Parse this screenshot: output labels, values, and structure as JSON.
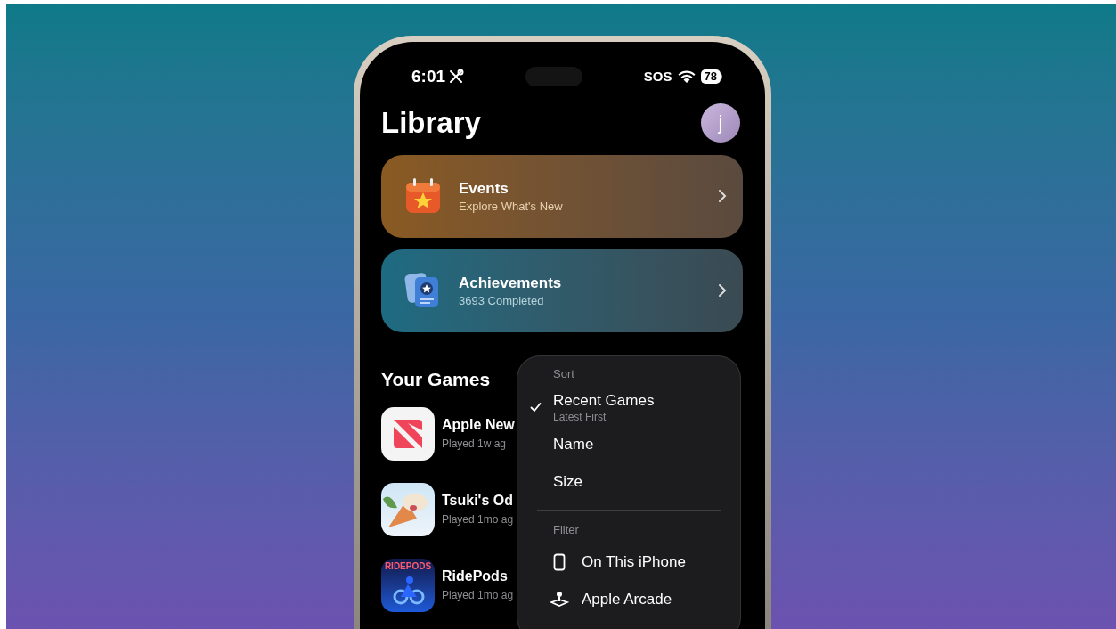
{
  "status_bar": {
    "time": "6:01",
    "sos": "SOS",
    "battery": "78"
  },
  "title": "Library",
  "avatar": {
    "initial": "j"
  },
  "cards": [
    {
      "kind": "events",
      "title": "Events",
      "subtitle": "Explore What's New"
    },
    {
      "kind": "achievements",
      "title": "Achievements",
      "subtitle": "3693 Completed"
    }
  ],
  "section_title": "Your Games",
  "games": [
    {
      "kind": "news",
      "title": "Apple New",
      "subtitle": "Played 1w ag"
    },
    {
      "kind": "tsuki",
      "title": "Tsuki's Od",
      "subtitle": "Played 1mo ag"
    },
    {
      "kind": "ridepods",
      "icon_label": "RIDEPODS",
      "title": "RidePods",
      "subtitle": "Played 1mo ag"
    }
  ],
  "menu": {
    "sections": [
      {
        "header": "Sort",
        "items": [
          {
            "label": "Recent Games",
            "detail": "Latest First",
            "selected": true
          },
          {
            "label": "Name",
            "selected": false
          },
          {
            "label": "Size",
            "selected": false
          }
        ]
      },
      {
        "header": "Filter",
        "items": [
          {
            "label": "On This iPhone",
            "kind": "device"
          },
          {
            "label": "Apple Arcade",
            "kind": "arcade"
          }
        ]
      }
    ]
  }
}
